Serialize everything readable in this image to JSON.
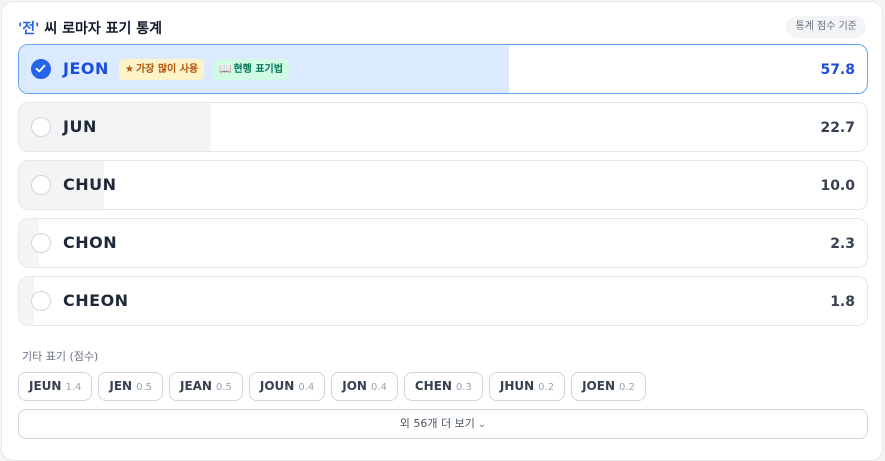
{
  "header": {
    "title_quoted": "'전'",
    "title_rest": " 씨 로마자 표기 통계",
    "basis_label": "통계 점수 기준"
  },
  "options": [
    {
      "label": "JEON",
      "score": "57.8",
      "fraction": 0.578,
      "selected": true
    },
    {
      "label": "JUN",
      "score": "22.7",
      "fraction": 0.227,
      "selected": false
    },
    {
      "label": "CHUN",
      "score": "10.0",
      "fraction": 0.1,
      "selected": false
    },
    {
      "label": "CHON",
      "score": "2.3",
      "fraction": 0.023,
      "selected": false
    },
    {
      "label": "CHEON",
      "score": "1.8",
      "fraction": 0.018,
      "selected": false
    }
  ],
  "badges": {
    "popular": {
      "icon": "star-icon",
      "label": "가장 많이 사용"
    },
    "standard": {
      "icon": "book-icon",
      "label": "현행 표기법"
    }
  },
  "others": {
    "label": "기타 표기 (점수)",
    "items": [
      {
        "name": "JEUN",
        "score": "1.4"
      },
      {
        "name": "JEN",
        "score": "0.5"
      },
      {
        "name": "JEAN",
        "score": "0.5"
      },
      {
        "name": "JOUN",
        "score": "0.4"
      },
      {
        "name": "JON",
        "score": "0.4"
      },
      {
        "name": "CHEN",
        "score": "0.3"
      },
      {
        "name": "JHUN",
        "score": "0.2"
      },
      {
        "name": "JOEN",
        "score": "0.2"
      }
    ]
  },
  "more_button": {
    "label": "외 56개 더 보기",
    "icon": "chevron-down-icon"
  },
  "colors": {
    "accent": "#2563eb",
    "selected_fill": "#dbeafe",
    "unselected_fill": "#f3f4f6"
  }
}
